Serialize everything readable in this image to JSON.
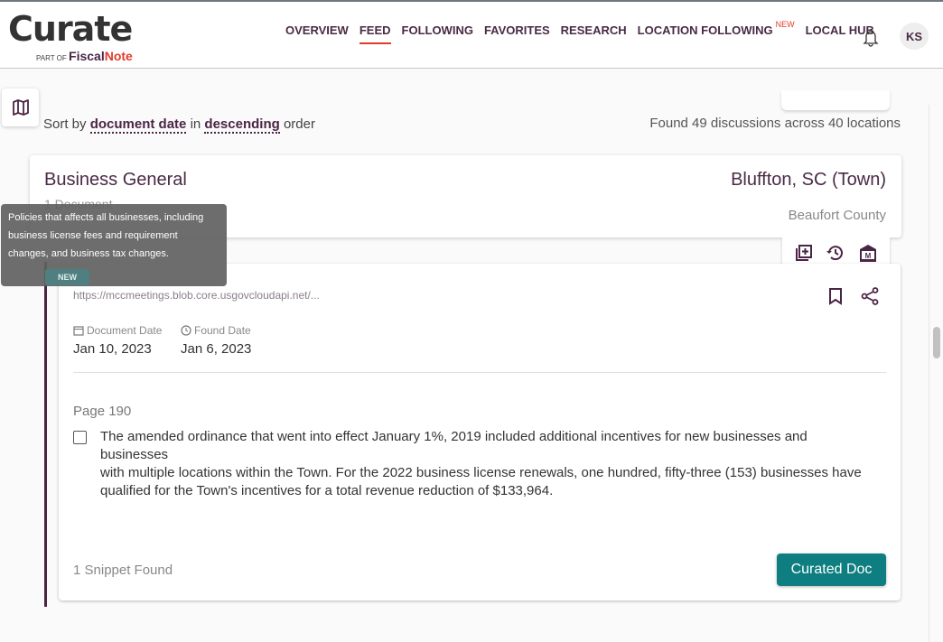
{
  "header": {
    "logo": {
      "main": "Curate",
      "sub_prefix": "PART OF",
      "sub_brand_a": "Fiscal",
      "sub_brand_b": "Note"
    },
    "nav": [
      {
        "label": "OVERVIEW",
        "active": false
      },
      {
        "label": "FEED",
        "active": true
      },
      {
        "label": "FOLLOWING",
        "active": false
      },
      {
        "label": "FAVORITES",
        "active": false
      },
      {
        "label": "RESEARCH",
        "active": false
      },
      {
        "label": "LOCATION FOLLOWING",
        "active": false,
        "badge": "NEW"
      },
      {
        "label": "LOCAL HUB",
        "active": false
      }
    ],
    "notifications_icon": "bell-icon",
    "avatar_initials": "KS"
  },
  "toolbar": {
    "map_icon": "map-icon",
    "sort_prefix": "Sort by",
    "sort_field": "document date",
    "sort_mid": "in",
    "sort_order": "descending",
    "sort_suffix": "order",
    "found_text": "Found 49 discussions across 40 locations"
  },
  "location_card": {
    "topic": "Business General",
    "document_count": "1 Document",
    "location": "Bluffton, SC (Town)",
    "county": "Beaufort County",
    "tray_icons": [
      "add-to-library-icon",
      "history-icon",
      "municipality-icon"
    ]
  },
  "tooltip": "Policies that affects all businesses, including business license fees and requirement changes, and business tax changes.",
  "document": {
    "badge": "NEW",
    "url": "https://mccmeetings.blob.core.usgovcloudapi.net/...",
    "document_date_label": "Document Date",
    "document_date": "Jan 10, 2023",
    "found_date_label": "Found Date",
    "found_date": "Jan 6, 2023",
    "page": "Page 190",
    "snippet_lines": [
      "The amended ordinance that went into effect January 1%, 2019 included additional incentives for new businesses and businesses",
      "with multiple locations within the Town. For the 2022 business license renewals, one hundred, fifty-three (153) businesses have",
      "qualified for the Town's incentives for a total revenue reduction of $133,964."
    ],
    "snippet_count": "1 Snippet Found",
    "curated_button": "Curated Doc"
  },
  "colors": {
    "brand_purple": "#4a2545",
    "accent_red": "#e03c2c",
    "teal": "#0e7e80"
  }
}
